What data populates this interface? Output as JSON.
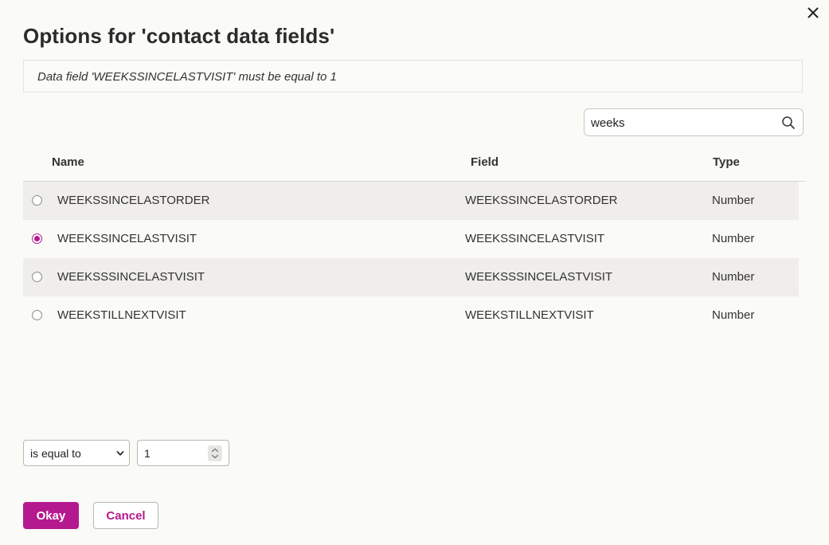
{
  "dialog": {
    "title": "Options for 'contact data fields'",
    "close_icon": "close-icon",
    "summary": "Data field 'WEEKSSINCELASTVISIT' must be equal to 1"
  },
  "search": {
    "value": "weeks",
    "icon": "search-icon"
  },
  "table": {
    "headers": {
      "name": "Name",
      "field": "Field",
      "type": "Type"
    },
    "rows": [
      {
        "name": "WEEKSSINCELASTORDER",
        "field": "WEEKSSINCELASTORDER",
        "type": "Number",
        "selected": false
      },
      {
        "name": "WEEKSSINCELASTVISIT",
        "field": "WEEKSSINCELASTVISIT",
        "type": "Number",
        "selected": true
      },
      {
        "name": "WEEKSSSINCELASTVISIT",
        "field": "WEEKSSSINCELASTVISIT",
        "type": "Number",
        "selected": false
      },
      {
        "name": "WEEKSTILLNEXTVISIT",
        "field": "WEEKSTILLNEXTVISIT",
        "type": "Number",
        "selected": false
      }
    ]
  },
  "condition": {
    "operator": "is equal to",
    "value": "1"
  },
  "buttons": {
    "okay": "Okay",
    "cancel": "Cancel"
  },
  "colors": {
    "accent": "#b5198f",
    "row_alt": "#efeeeb",
    "background": "#fafaf7"
  }
}
